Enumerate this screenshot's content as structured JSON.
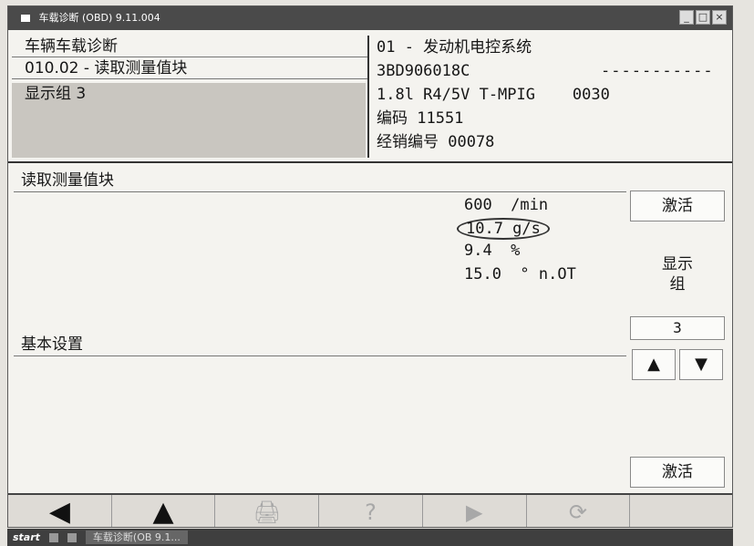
{
  "window": {
    "title": "车载诊断 (OBD) 9.11.004"
  },
  "header": {
    "function_title": "车辆车载诊断",
    "function_path": "010.02 - 读取测量值块",
    "display_group": "显示组 3",
    "system": "01 - 发动机电控系统",
    "part_number": "3BD906018C",
    "dashes": "-----------",
    "engine": "1.8l R4/5V T-MPIG    0030",
    "code": "编码 11551",
    "dealer": "经销编号 00078"
  },
  "section": {
    "title": "读取测量值块"
  },
  "measurements": [
    {
      "text": "600  /min"
    },
    {
      "text": "10.7 g/s"
    },
    {
      "text": "9.4  %"
    },
    {
      "text": "15.0  ° n.OT"
    }
  ],
  "basic_settings": {
    "title": "基本设置"
  },
  "side": {
    "activate_top": "激活",
    "display_group_line1": "显示",
    "display_group_line2": "组",
    "group_number": "3",
    "up_arrow": "▲",
    "down_arrow": "▼",
    "activate_bottom": "激活"
  },
  "toolbar": {
    "back": "◀",
    "up": "▲",
    "print": "🖨",
    "help": "?",
    "forward": "▶",
    "refresh": "⟳"
  },
  "taskbar": {
    "start": "start",
    "task": "车载诊断(OB 9.1..."
  },
  "icons": {
    "back": "back-icon",
    "up": "up-icon",
    "print": "print-icon",
    "help": "help-icon",
    "forward": "forward-icon",
    "refresh": "refresh-icon"
  }
}
